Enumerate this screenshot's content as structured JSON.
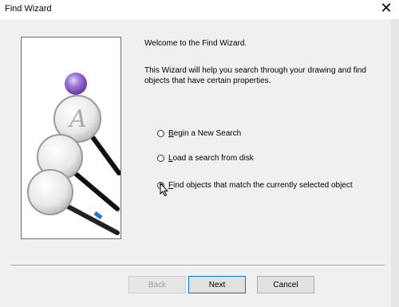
{
  "window": {
    "title": "Find Wizard"
  },
  "intro": {
    "welcome": "Welcome to the Find Wizard.",
    "description": "This Wizard will help you search through your drawing and find objects that have certain properties."
  },
  "options": [
    {
      "label": "Begin a New Search",
      "mnemonic": "B",
      "rest": "egin a New Search",
      "checked": false
    },
    {
      "label": "Load a search from disk",
      "mnemonic": "L",
      "rest": "oad a search from disk",
      "checked": false
    },
    {
      "label": "Find objects that match the currently selected object",
      "mnemonic": "F",
      "rest": "ind objects that match the currently selected object",
      "checked": true
    }
  ],
  "buttons": {
    "back": "Back",
    "next": "Next",
    "cancel": "Cancel"
  },
  "icons": [
    "close-icon",
    "magnifier-illustration",
    "cursor-icon"
  ],
  "colors": {
    "accent": "#0078d7",
    "panel": "#f0f0f0"
  }
}
